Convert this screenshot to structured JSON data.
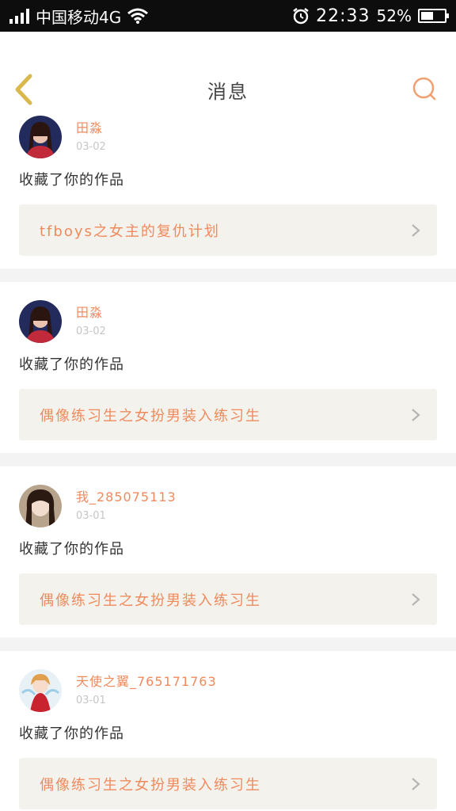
{
  "status_bar": {
    "carrier": "中国移动4G",
    "time": "22:33",
    "battery_text": "52%",
    "battery_level": 0.52,
    "icons": [
      "signal-icon",
      "wifi-icon",
      "alarm-icon",
      "battery-icon"
    ]
  },
  "nav": {
    "title": "消息",
    "back_icon": "chevron-left-icon",
    "search_icon": "search-icon"
  },
  "messages": [
    {
      "user": "田淼",
      "time": "03-02",
      "action": "收藏了你的作品",
      "work": "tfboys之女主的复仇计划"
    },
    {
      "user": "田淼",
      "time": "03-02",
      "action": "收藏了你的作品",
      "work": "偶像练习生之女扮男装入练习生"
    },
    {
      "user": "我_285075113",
      "time": "03-01",
      "action": "收藏了你的作品",
      "work": "偶像练习生之女扮男装入练习生"
    },
    {
      "user": "天使之翼_765171763",
      "time": "03-01",
      "action": "收藏了你的作品",
      "work": "偶像练习生之女扮男装入练习生"
    }
  ],
  "colors": {
    "accent": "#f08a5d",
    "back_icon": "#d9b94e",
    "card_bg": "#f3f2ec"
  }
}
